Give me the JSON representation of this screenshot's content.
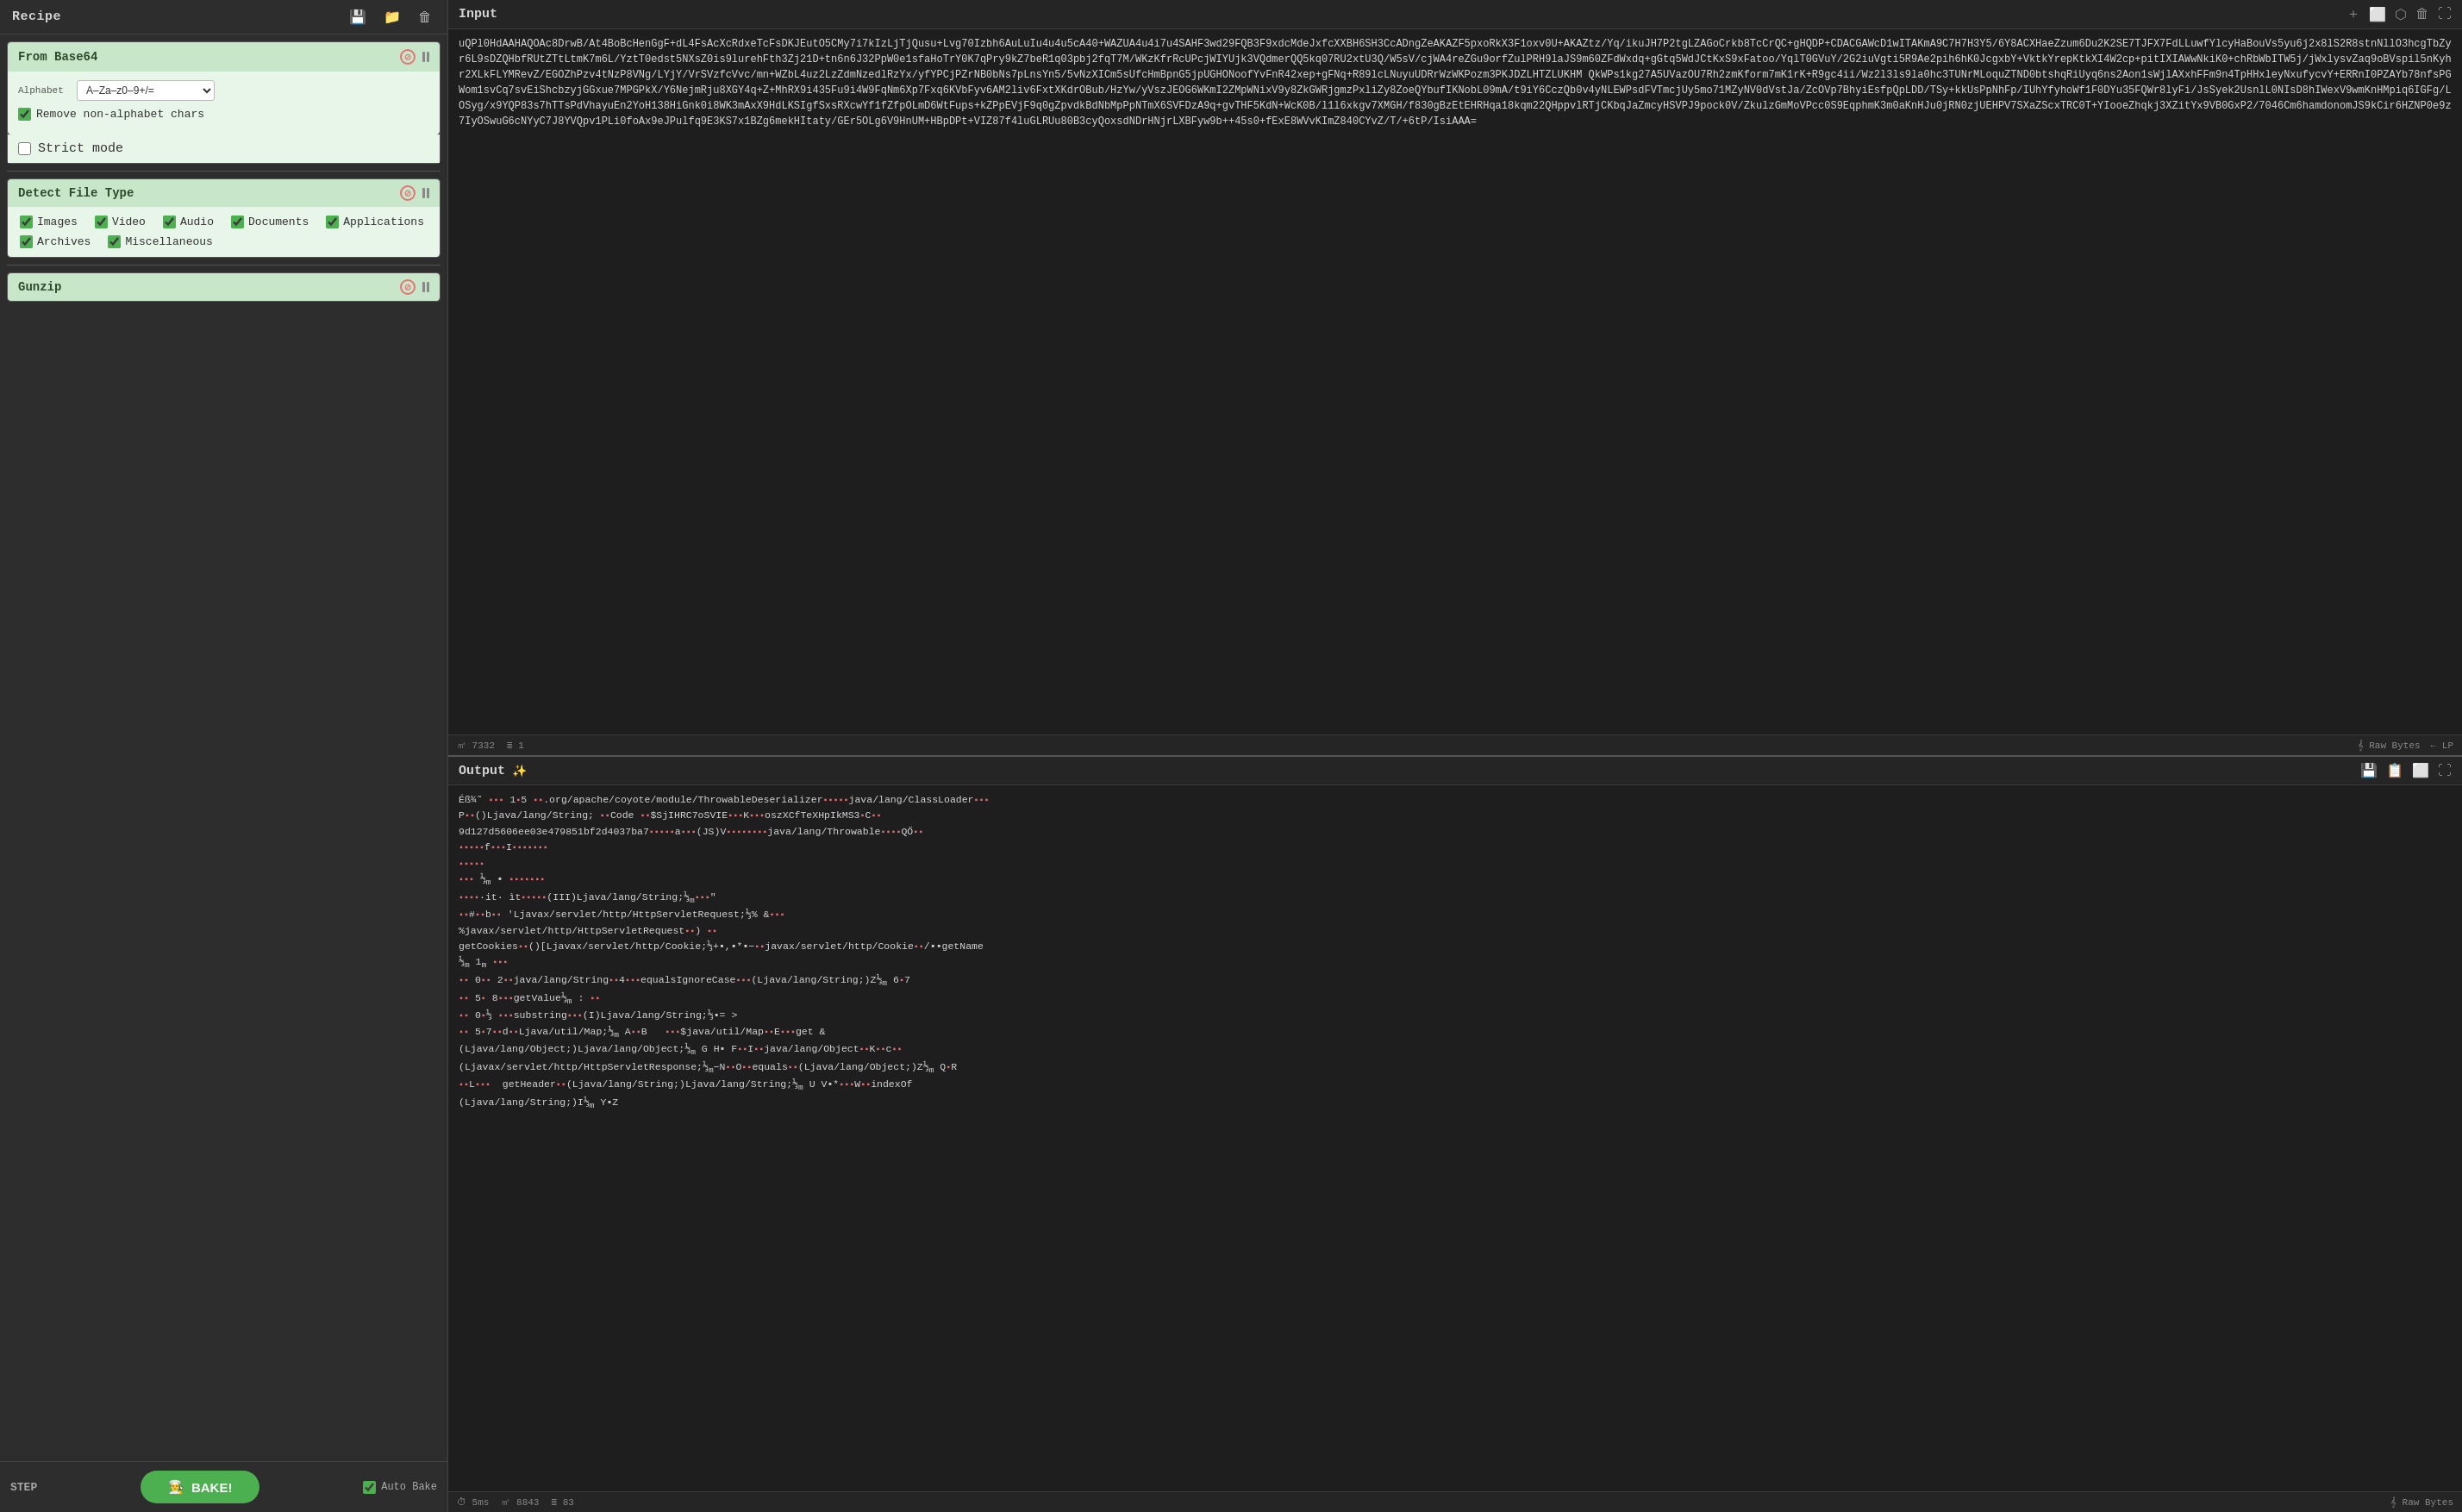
{
  "recipe": {
    "title": "Recipe",
    "icons": [
      "save",
      "folder",
      "trash"
    ],
    "from_base64": {
      "title": "From Base64",
      "alphabet_label": "Alphabet",
      "alphabet_value": "A–Za–z0–9+/=",
      "remove_non_alpha_label": "Remove non-alphabet chars",
      "remove_non_alpha_checked": true,
      "strict_mode_label": "Strict mode",
      "strict_mode_checked": false
    },
    "detect_file_type": {
      "title": "Detect File Type",
      "types": [
        {
          "label": "Images",
          "checked": true
        },
        {
          "label": "Video",
          "checked": true
        },
        {
          "label": "Audio",
          "checked": true
        },
        {
          "label": "Documents",
          "checked": true
        },
        {
          "label": "Applications",
          "checked": true
        },
        {
          "label": "Archives",
          "checked": true
        },
        {
          "label": "Miscellaneous",
          "checked": true
        }
      ]
    },
    "gunzip": {
      "title": "Gunzip"
    }
  },
  "bottom_bar": {
    "step_label": "STEP",
    "bake_label": "BAKE!",
    "auto_bake_label": "Auto Bake",
    "auto_bake_checked": true
  },
  "input": {
    "title": "Input",
    "content": "uQPl0HdAAHAQOAc8DrwB/At4BoBcHenGgF+dL4FsAcXcRdxeTcFsDKJEutO5CMy7i7kIzLjTjQusu+Lvg70Izbh6AuLuIu4u4u5cA40+WAZUA4u4i7u4SAHF3wd29FQB3F9xdcMdeJxfcXXBH6SH3CcADngZeAKAZF5pxoRkX3F1oxv0U+AKAZtz/Yq/ikuJH7P2tgLZAGoCrkb8TcCrQC+gHQDP+CDACGAWcD1wITAKmA9C7H7H3Y5/6Y8ACXHaeZzum6Du2K2SE7TJFX7FdLLuwfYlcyHaBouVs5yu6j2x8lS2R8stnNllO3hcgTbZyr6L9sDZQHbfRUtZTtLtmK7m6L/YztT0edst5NXsZ0is9lurehFth3Zj21D+tn6n6J32PpW0e1sfaHoTrY0K7qPry9kZ7beR1q03pbj2fqT7M/WKzKfrRcUPcjWIYUjk3VQdmerQQ5kq07RU2xtU3Q/W5sV/cjWA4reZGu9orfZulPRH9laJS9m60ZFdWxdq+gGtq5WdJCtKxS9xFatoo/YqlT0GVuY/2G2iuVgti5R9Ae2pih6hK0JcgxbY+VktkYrepKtkXI4W2cp+pitIXIAWwNkiK0+chRbWbITW5j/jWxlysvZaq9oBVspil5nKyhr2XLkFLYMRevZ/EGOZhPzv4tNzP8VNg/LYjY/VrSVzfcVvc/mn+WZbL4uz2LzZdmNzedlRzYx/yfYPCjPZrNB0bNs7pLnsYn5/5vNzXICm5sUfcHmBpnG5jpUGHONoofYvFnR42xep+gFNq+R89lcLNuyuUDRrWzWKPozm3PKJDZLHTZLUKHM QkWPs1kg27A5UVazOU7Rh2zmKform7mK1rK+R9gc4ii/Wz2l3ls9la0hc3TUNrMLoquZTND0btshqRiUyq6ns2Aon1sWjlAXxhFFm9n4TpHHxleyNxufycvY+ERRnI0PZAYb78nfsPGWom1svCq7svEiShcbzyjGGxue7MPGPkX/Y6NejmRju8XGY4q+Z+MhRX9i435Fu9i4W9FqNm6Xp7Fxq6KVbFyv6AM2liv6FxtXKdrOBub/HzYw/yVszJEOG6WKmI2ZMpWNixV9y8ZkGWRjgmzPxliZy8ZoeQYbufIKNobL09mA/t9iY6CczQb0v4yNLEWPsdFVTmcjUy5mo71MZyNV0dVstJa/ZcOVp7BhyiEsfpQpLDD/TSy+kkUsPpNhFp/IUhYfyhoWf1F0DYu35FQWr8lyFi/JsSyek2UsnlL0NIsD8hIWexV9wmKnHMpiq6IGFg/LOSyg/x9YQP83s7hTTsPdVhayuEn2YoH138HiGnk0i8WK3mAxX9HdLKSIgfSxsRXcwYf1fZfpOLmD6WtFups+kZPpEVjF9q0gZpvdkBdNbMpPpNTmX6SVFDzA9q+gvTHF5KdN+WcK0B/l1l6xkgv7XMGH/f830gBzEtEHRHqa18kqm22QHppvlRTjCKbqJaZmcyHSVPJ9pock0V/ZkulzGmMoVPcc0S9EqphmK3m0aKnHJu0jRN0zjUEHPV7SXaZScxTRC0T+YIooeZhqkj3XZitYx9VB0GxP2/7046Cm6hamdonomJS9kCir6HZNP0e9z7IyOSwuG6cNYyC7J8YVQpv1PLi0foAx9eJPulfq9E3KS7x1BZg6mekHItaty/GEr5OLg6V9HnUM+HBpDPt+VIZ87f4luGLRUu80B3cyQoxsdNDrHNjrLXBFyw9b++45s0+fExE8WVvKImZ840CYvZ/T/+6tP/IsiAAA=",
    "footer": {
      "bytes": "7332",
      "lines": "1",
      "bytes_label": "mec",
      "lines_label": "Raw Bytes",
      "lp_label": "LP"
    }
  },
  "output": {
    "title": "Output",
    "footer": {
      "bytes": "8843",
      "lines": "83",
      "time": "5ms",
      "format_label": "Raw Bytes"
    }
  }
}
